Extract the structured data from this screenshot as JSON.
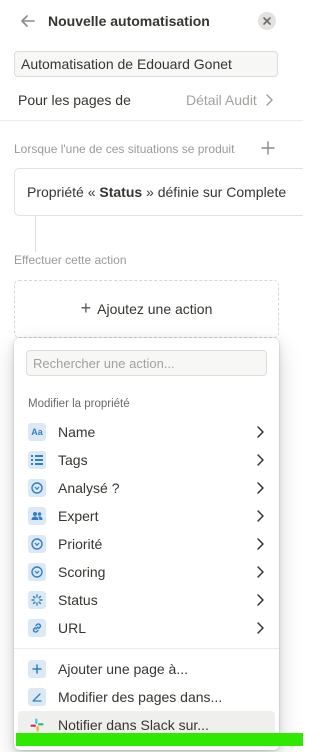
{
  "header": {
    "title": "Nouvelle automatisation"
  },
  "automation_name": "Automatisation de Edouard Gonet",
  "pages": {
    "label": "Pour les pages de",
    "value": "Détail Audit"
  },
  "trigger": {
    "section_label": "Lorsque l'une de ces situations se produit",
    "prefix": "Propriété « ",
    "property": "Status",
    "suffix": " » définie sur Complete"
  },
  "action": {
    "section_label": "Effectuer cette action",
    "add_label": "Ajoutez une action"
  },
  "menu": {
    "search_placeholder": "Rechercher une action...",
    "section_title": "Modifier la propriété",
    "properties": [
      {
        "label": "Name",
        "icon": "text-aa-icon"
      },
      {
        "label": "Tags",
        "icon": "list-icon"
      },
      {
        "label": "Analysé ?",
        "icon": "select-icon"
      },
      {
        "label": "Expert",
        "icon": "people-icon"
      },
      {
        "label": "Priorité",
        "icon": "select-icon"
      },
      {
        "label": "Scoring",
        "icon": "select-icon"
      },
      {
        "label": "Status",
        "icon": "status-icon"
      },
      {
        "label": "URL",
        "icon": "link-icon"
      }
    ],
    "other_actions": [
      {
        "label": "Ajouter une page à...",
        "icon": "plus-icon"
      },
      {
        "label": "Modifier des pages dans...",
        "icon": "edit-icon"
      },
      {
        "label": "Notifier dans Slack sur...",
        "icon": "slack-icon"
      }
    ]
  },
  "colors": {
    "accent_blue": "#2f80c7",
    "icon_bg": "#dce9f5",
    "highlight_bar": "#31e800"
  }
}
